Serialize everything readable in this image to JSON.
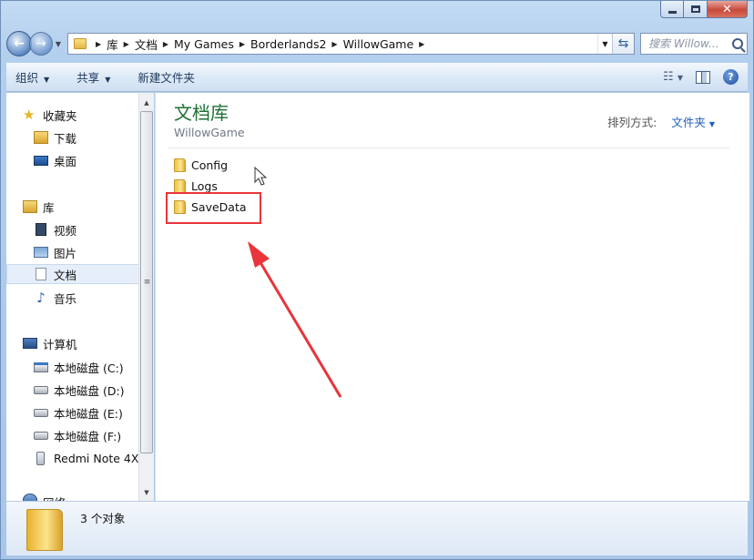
{
  "address": {
    "crumbs": [
      "库",
      "文档",
      "My Games",
      "Borderlands2",
      "WillowGame"
    ]
  },
  "search": {
    "placeholder": "搜索 Willow..."
  },
  "toolbar": {
    "organize": "组织",
    "share": "共享",
    "new_folder": "新建文件夹"
  },
  "sidebar": {
    "favorites": "收藏夹",
    "downloads": "下载",
    "desktop": "桌面",
    "libraries": "库",
    "videos": "视频",
    "pictures": "图片",
    "documents": "文档",
    "music": "音乐",
    "computer": "计算机",
    "drive_c": "本地磁盘 (C:)",
    "drive_d": "本地磁盘 (D:)",
    "drive_e": "本地磁盘 (E:)",
    "drive_f": "本地磁盘 (F:)",
    "phone": "Redmi Note 4X",
    "network": "网络"
  },
  "content": {
    "title": "文档库",
    "subtitle": "WillowGame",
    "arrange_label": "排列方式:",
    "arrange_value": "文件夹",
    "files": [
      {
        "name": "Config"
      },
      {
        "name": "Logs"
      },
      {
        "name": "SaveData"
      }
    ]
  },
  "status": {
    "count": "3 个对象"
  },
  "colors": {
    "library_title": "#1e7134",
    "highlight": "#e8343a",
    "link": "#1f5fb7"
  }
}
